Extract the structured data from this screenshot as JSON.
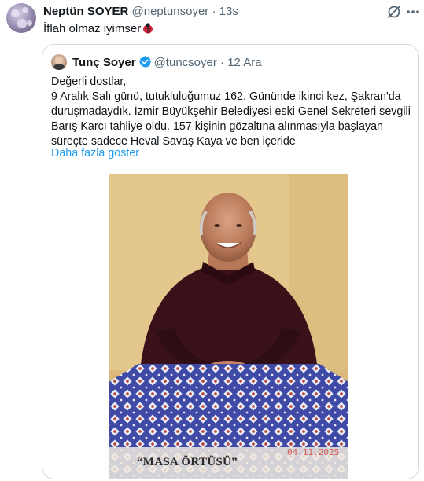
{
  "tweet": {
    "author_name": "Neptün SOYER",
    "author_handle": "@neptunsoyer",
    "separator": "·",
    "time": "13s",
    "text": "İflah olmaz iyimser",
    "emoji_icon": "ladybug-icon"
  },
  "quoted_tweet": {
    "author_name": "Tunç Soyer",
    "author_handle": "@tuncsoyer",
    "separator": "·",
    "time": "12 Ara",
    "verified_icon": "verified-badge-icon",
    "accent_color": "#1d9bf0",
    "body": "Değerli dostlar,\n9 Aralık Salı günü, tutukluluğumuz 162. Gününde ikinci kez, Şakran'da duruşmadaydık. İzmir Büyükşehir Belediyesi eski Genel Sekreteri sevgili Barış Karcı tahliye oldu. 157 kişinin gözaltına alınmasıyla başlayan süreçte sadece Heval Savaş Kaya ve ben içeride",
    "show_more_label": "Daha fazla göster",
    "photo": {
      "caption": "“MASA ÖRTÜSÜ”",
      "date_stamp": "04.11.2025"
    }
  },
  "actions": {
    "grok_icon": "grok-icon",
    "more_icon": "more-options-icon"
  }
}
